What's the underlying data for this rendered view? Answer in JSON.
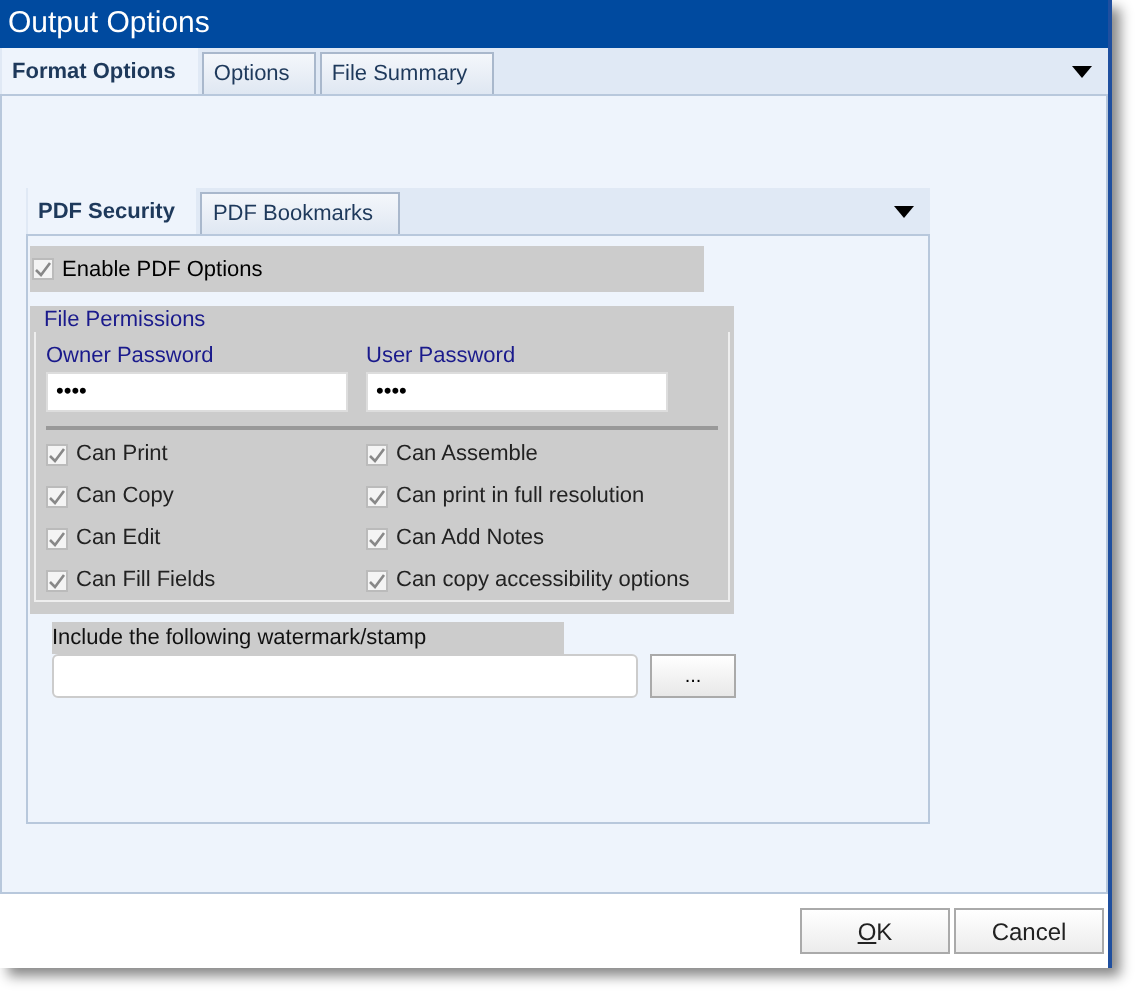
{
  "window": {
    "title": "Output Options"
  },
  "tabs": [
    {
      "label": "Format Options",
      "selected": true
    },
    {
      "label": "Options",
      "selected": false
    },
    {
      "label": "File Summary",
      "selected": false
    }
  ],
  "inner_tabs": [
    {
      "label": "PDF Security",
      "selected": true
    },
    {
      "label": "PDF Bookmarks",
      "selected": false
    }
  ],
  "enable_pdf_options": {
    "label": "Enable PDF Options",
    "checked": true
  },
  "file_permissions": {
    "title": "File Permissions",
    "owner_password": {
      "label": "Owner Password",
      "value": "••••"
    },
    "user_password": {
      "label": "User Password",
      "value": "••••"
    },
    "permissions": [
      {
        "label": "Can Print",
        "checked": true
      },
      {
        "label": "Can Assemble",
        "checked": true
      },
      {
        "label": "Can Copy",
        "checked": true
      },
      {
        "label": "Can print in full resolution",
        "checked": true
      },
      {
        "label": "Can Edit",
        "checked": true
      },
      {
        "label": "Can Add Notes",
        "checked": true
      },
      {
        "label": "Can Fill Fields",
        "checked": true
      },
      {
        "label": "Can copy accessibility options",
        "checked": true
      }
    ]
  },
  "watermark": {
    "label": "Include the following watermark/stamp",
    "browse_button": "..."
  },
  "buttons": [
    "OK",
    "Cancel"
  ]
}
